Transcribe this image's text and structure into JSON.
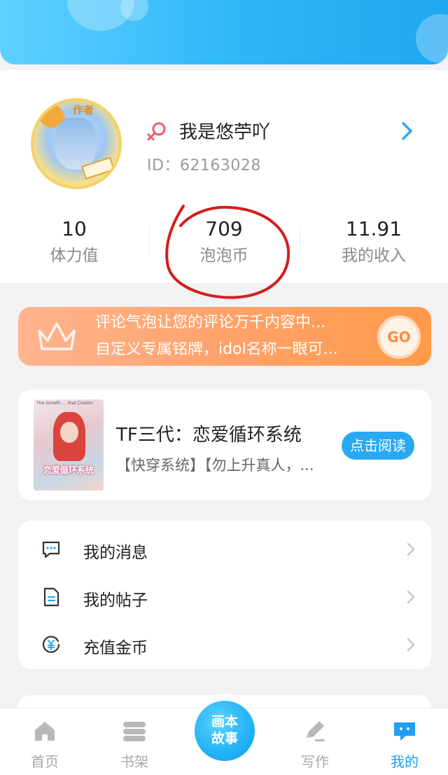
{
  "profile": {
    "author_tag": "作者",
    "nickname": "我是悠苧吖",
    "user_id": "ID：62163028"
  },
  "stats": [
    {
      "value": "10",
      "label": "体力值"
    },
    {
      "value": "709",
      "label": "泡泡币"
    },
    {
      "value": "11.91",
      "label": "我的收入"
    }
  ],
  "vip_banner": {
    "line1": "评论气泡让您的评论万千内容中...",
    "line2": "自定义专属铭牌，idol名称一眼可...",
    "go_label": "GO"
  },
  "book": {
    "cover_header": "The Growth … that Creator",
    "cover_title": "恋爱循环系统",
    "title": "TF三代：恋爱循环系统",
    "description": "【快穿系统】【勿上升真人，...",
    "read_label": "点击阅读"
  },
  "menu": {
    "items": [
      {
        "label": "我的消息",
        "icon": "message-icon"
      },
      {
        "label": "我的帖子",
        "icon": "document-icon"
      },
      {
        "label": "充值金币",
        "icon": "yuan-coin-icon"
      }
    ]
  },
  "tabbar": {
    "tabs": [
      {
        "label": "首页",
        "icon": "home-icon"
      },
      {
        "label": "书架",
        "icon": "bookshelf-icon"
      },
      {
        "label": "写作",
        "icon": "pencil-icon"
      },
      {
        "label": "我的",
        "icon": "chat-bubble-icon"
      }
    ],
    "center_line1": "画本",
    "center_line2": "故事",
    "active_tab": "我的"
  },
  "colors": {
    "accent": "#1f9ef2",
    "banner_orange": "#ff9a4a",
    "circle_annotation": "#d41d1d"
  }
}
